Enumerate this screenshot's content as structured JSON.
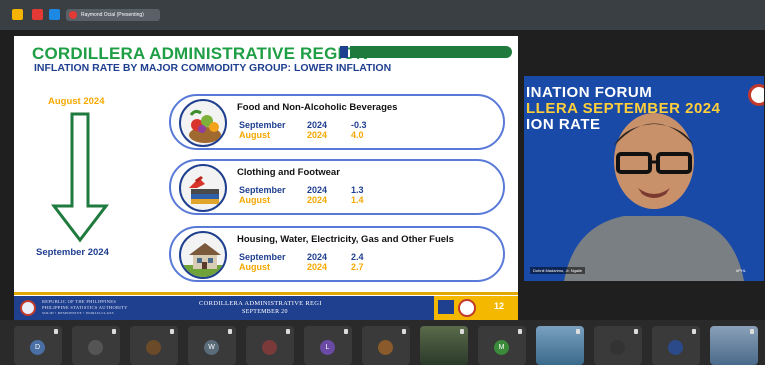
{
  "window": {
    "presenting_label": "Raymond Ocial (Presenting)"
  },
  "slide": {
    "title": "CORDILLERA ADMINISTRATIVE REGION",
    "subtitle": "INFLATION RATE BY MAJOR COMMODITY GROUP: LOWER INFLATION",
    "from_label": "August 2024",
    "to_label": "September 2024",
    "cards": [
      {
        "title": "Food and Non-Alcoholic Beverages",
        "rows": [
          {
            "month": "September",
            "year": "2024",
            "value": "-0.3"
          },
          {
            "month": "August",
            "year": "2024",
            "value": "4.0"
          }
        ]
      },
      {
        "title": "Clothing and Footwear",
        "rows": [
          {
            "month": "September",
            "year": "2024",
            "value": "1.3"
          },
          {
            "month": "August",
            "year": "2024",
            "value": "1.4"
          }
        ]
      },
      {
        "title": "Housing, Water, Electricity, Gas and Other Fuels",
        "rows": [
          {
            "month": "September",
            "year": "2024",
            "value": "2.4"
          },
          {
            "month": "August",
            "year": "2024",
            "value": "2.7"
          }
        ]
      }
    ],
    "footer": {
      "psa_line1": "REPUBLIC OF THE PHILIPPINES",
      "psa_line2": "PHILIPPINE STATISTICS AUTHORITY",
      "psa_line3": "SOLID • RESPONSIVE • WORLD-CLASS",
      "center_line1": "CORDILLERA ADMINISTRATIVE REGI",
      "center_line2": "SEPTEMBER 20",
      "page_number": "12"
    }
  },
  "video": {
    "bg_line1": "INATION FORUM",
    "bg_line2": "LLERA SEPTEMBER 2024",
    "bg_line3": "ION RATE",
    "name_tag": "Dohnli Madarimo, Jr. Ngaile",
    "corner_tag": "#PHL"
  },
  "participants": [
    {
      "initial": "D",
      "color": "#4a6fa5"
    },
    {
      "initial": "",
      "color": "#555"
    },
    {
      "initial": "",
      "color": "#6b4a2a"
    },
    {
      "initial": "W",
      "color": "#5a6b7a"
    },
    {
      "initial": "",
      "color": "#7a3a3a"
    },
    {
      "initial": "L",
      "color": "#6a4aa5"
    },
    {
      "initial": "",
      "color": "#8a5a2a"
    },
    {
      "initial": "",
      "color": "#2a5a3a"
    },
    {
      "initial": "M",
      "color": "#3a8a3a"
    },
    {
      "initial": "",
      "color": "#3a6a8a"
    },
    {
      "initial": "",
      "color": "#333"
    },
    {
      "initial": "",
      "color": "#2a4a8a"
    },
    {
      "initial": "",
      "color": "#4a6a8a"
    }
  ]
}
